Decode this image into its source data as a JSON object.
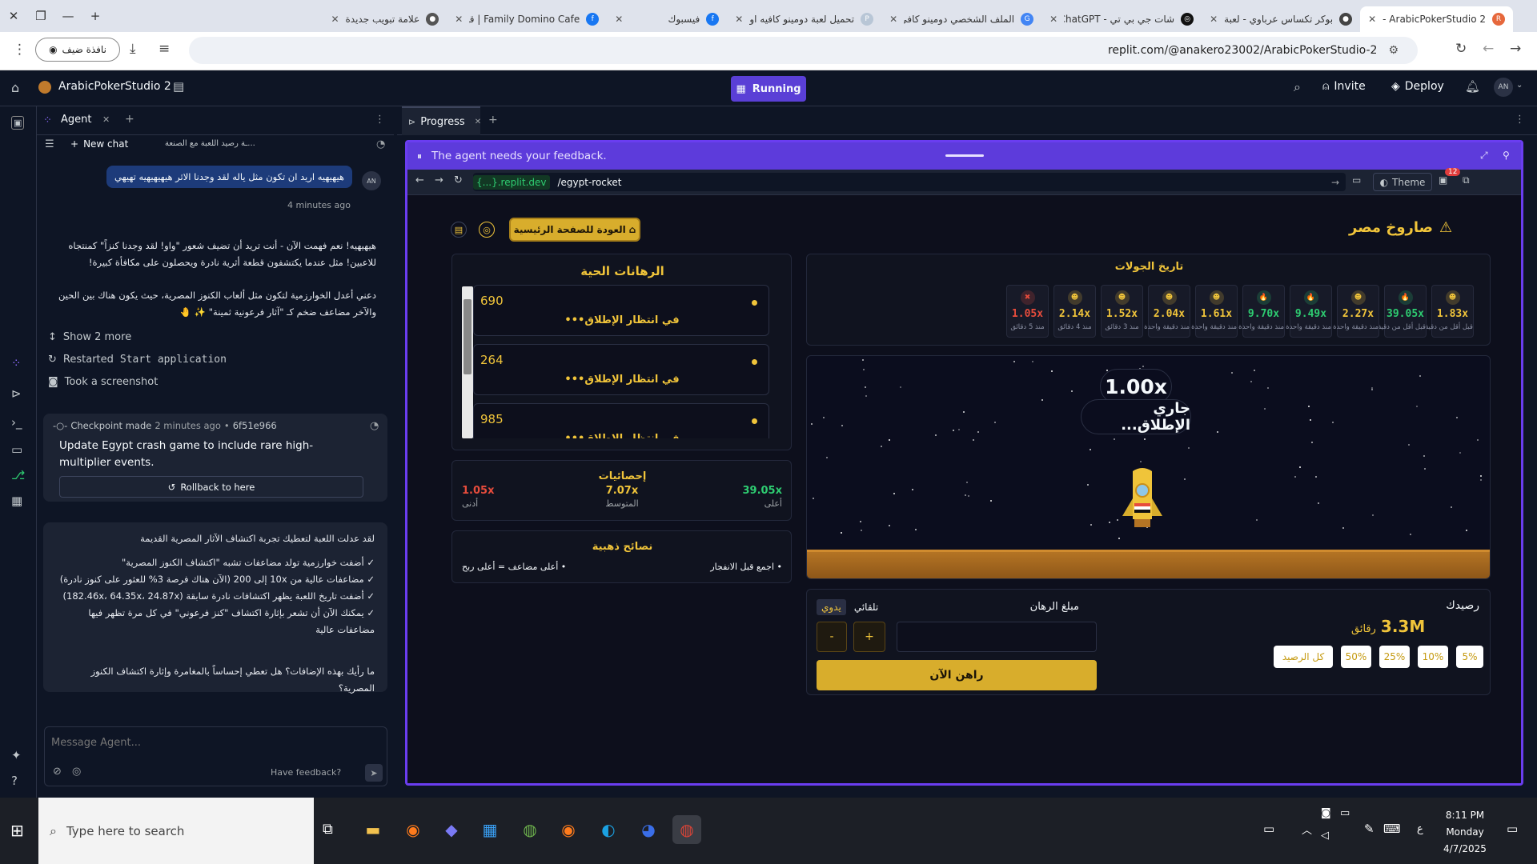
{
  "browser": {
    "tabs": [
      {
        "title": "ArabicPokerStudio 2 -",
        "active": true,
        "fav": "R",
        "color": "#e6683c"
      },
      {
        "title": "بوكر تكساس عرباوي - لعبة",
        "fav": "●",
        "color": "#444"
      },
      {
        "title": "شات جي بي تي - ChatGPT",
        "fav": "◎",
        "color": "#111"
      },
      {
        "title": "الملف الشخصي دومينو كافي",
        "fav": "G",
        "color": "#4285f4"
      },
      {
        "title": "تحميل لعبة دومينو كافيه او",
        "fav": "P",
        "color": "#b8c6d6"
      },
      {
        "title": "فيسبوك",
        "fav": "f",
        "color": "#1877f2"
      },
      {
        "title": "Family Domino Cafe | قية",
        "fav": "f",
        "color": "#1877f2"
      },
      {
        "title": "علامة تبويب جديدة",
        "fav": "●",
        "color": "#555"
      }
    ],
    "guest_label": "نافذة ضيف",
    "url": "replit.com/@anakero23002/ArabicPokerStudio-2"
  },
  "replit": {
    "project_name": "ArabicPokerStudio 2",
    "run_status": "Running",
    "invite": "Invite",
    "deploy": "Deploy",
    "avatar": "AN"
  },
  "agent": {
    "tab_label": "Agent",
    "new_chat": "New chat",
    "chat_title": "...ـة رصيد اللعبة مع الصنعة",
    "user_message": "هيهيهيه اريد ان تكون مثل ياله لقد وجدنا الاثر هيهيهيهيه تهيهي",
    "user_avatar": "AN",
    "time_ago": "4 minutes ago",
    "reply_p1": "هيهيهيه! نعم فهمت الآن - أنت تريد أن تضيف شعور \"واو! لقد وجدنا كنزاً\" كمنتجاه للاعبين! مثل عندما يكتشفون قطعة أثرية نادرة ويحصلون على مكافأة كبيرة!",
    "reply_p2": "دعني أعدل الخوارزمية لتكون مثل ألعاب الكنوز المصرية، حيث يكون هناك بين الحين والآخر مضاعف ضخم كـ \"آثار فرعونية ثمينة\" ✨ 🤚",
    "show_more": "Show 2 more",
    "restarted_prefix": "Restarted",
    "restarted_code": "Start application",
    "took_screenshot": "Took a screenshot",
    "checkpoint_label": "Checkpoint made",
    "checkpoint_time": "2 minutes ago",
    "checkpoint_hash": "6f51e966",
    "checkpoint_title": "Update Egypt crash game to include rare high-multiplier events.",
    "rollback": "Rollback to here",
    "summary_title": "لقد عدلت اللعبة لتعطيك تجربة اكتشاف الآثار المصرية القديمة",
    "summary_items": [
      "✓ أضفت خوارزمية تولد مضاعفات تشبه \"اكتشاف الكنوز المصرية\"",
      "✓ مضاعفات عالية من 10x إلى 200 (الآن هناك فرصة 3% للعثور على كنوز نادرة)",
      "✓ أضفت تاريخ اللعبة يظهر اكتشافات نادرة سابقة (182.46x، 64.35x، 24.87x)",
      "✓ يمكنك الآن أن تشعر بإثارة اكتشاف \"كنز فرعوني\" في كل مرة تظهر فيها مضاعفات عالية"
    ],
    "summary_question": "ما رأيك بهذه الإضافات؟ هل تعطي إحساساً بالمغامرة وإثارة اكتشاف الكنوز المصرية؟",
    "message_placeholder": "Message Agent...",
    "have_feedback": "Have feedback?"
  },
  "preview": {
    "tab_label": "Progress",
    "feedback_text": "The agent needs your feedback.",
    "domain": "{...}.replit.dev",
    "path": "/egypt-rocket",
    "theme": "Theme",
    "notif_count": "12"
  },
  "game": {
    "title": "صاروخ مصر",
    "back_home": "العودة للصفحة الرئيسية",
    "history_title": "تاريخ الجولات",
    "history": [
      {
        "value": "1.83x",
        "time": "قبل أقل من دقيقة",
        "color": "#f0c43a",
        "icon": "☻"
      },
      {
        "value": "39.05x",
        "time": "قبل أقل من دقيقة",
        "color": "#2ecc71",
        "icon": "🔥"
      },
      {
        "value": "2.27x",
        "time": "منذ دقيقة واحدة",
        "color": "#f0c43a",
        "icon": "☻"
      },
      {
        "value": "9.49x",
        "time": "منذ دقيقة واحدة",
        "color": "#2ecc71",
        "icon": "🔥"
      },
      {
        "value": "9.70x",
        "time": "منذ دقيقة واحدة",
        "color": "#2ecc71",
        "icon": "🔥"
      },
      {
        "value": "1.61x",
        "time": "منذ دقيقة واحدة",
        "color": "#f0c43a",
        "icon": "☻"
      },
      {
        "value": "2.04x",
        "time": "منذ دقيقة واحدة",
        "color": "#f0c43a",
        "icon": "☻"
      },
      {
        "value": "1.52x",
        "time": "منذ 3 دقائق",
        "color": "#f0c43a",
        "icon": "☻"
      },
      {
        "value": "2.14x",
        "time": "منذ 4 دقائق",
        "color": "#f0c43a",
        "icon": "☻"
      },
      {
        "value": "1.05x",
        "time": "منذ 5 دقائق",
        "color": "#e74c3c",
        "icon": "✖"
      }
    ],
    "multiplier": "1.00x",
    "launching": "جاري الإطلاق...",
    "live_bets_title": "الرهانات الحية",
    "live_bets": [
      {
        "amount": "690",
        "status": "في انتظار الإطلاق•••"
      },
      {
        "amount": "264",
        "status": "في انتظار الإطلاق•••"
      },
      {
        "amount": "985",
        "status": "في انتظار الإطلاق•••"
      }
    ],
    "stats_title": "إحصائيات",
    "stats": [
      {
        "value": "39.05x",
        "label": "أعلى",
        "color": "#2ecc71"
      },
      {
        "value": "7.07x",
        "label": "المتوسط",
        "color": "#f0c43a"
      },
      {
        "value": "1.05x",
        "label": "أدنى",
        "color": "#e74c3c"
      }
    ],
    "tips_title": "نصائح ذهبية",
    "tips": [
      "• اجمع قبل الانفجار",
      "• أعلى مضاعف = أعلى ربح"
    ],
    "balance_label": "رصيدك",
    "balance_value": "3.3M",
    "balance_unit": "رقائق",
    "bet_amount_label": "مبلغ الرهان",
    "auto_label": "تلقائي",
    "manual_label": "يدوي",
    "plus": "+",
    "minus": "-",
    "percent_buttons": [
      "5%",
      "10%",
      "25%",
      "50%",
      "كل الرصيد"
    ],
    "bet_now": "راهن الآن"
  },
  "taskbar": {
    "search_placeholder": "Type here to search",
    "time": "8:11 PM",
    "day": "Monday",
    "date": "4/7/2025",
    "lang": "ع"
  }
}
